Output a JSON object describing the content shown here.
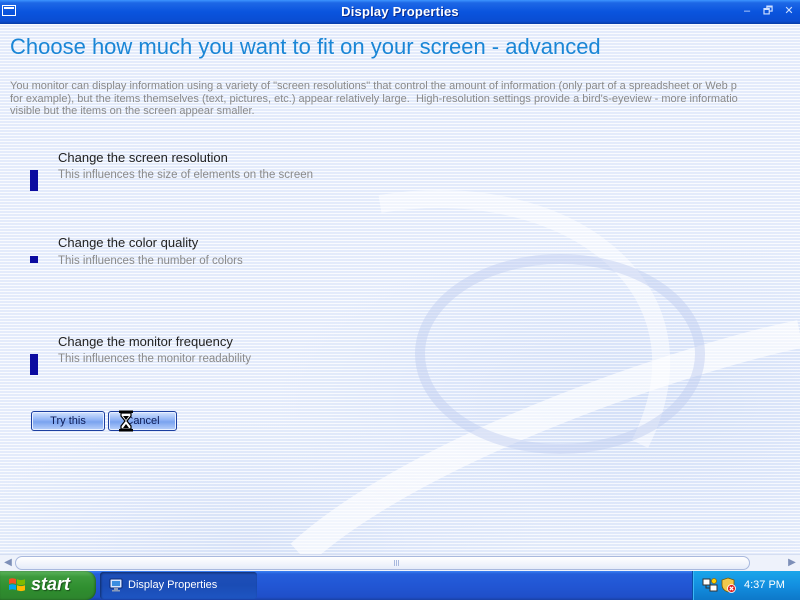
{
  "window": {
    "title": "Display Properties",
    "controls": {
      "minimize": "–",
      "restore": "🗗",
      "close": "✕"
    }
  },
  "page": {
    "heading": "Choose how much you want to fit on your screen - advanced",
    "intro": "You monitor can display information using a variety of \"screen resolutions\" that control the amount of information (only part of a spreadsheet or Web p\nfor example), but the items themselves (text, pictures, etc.) appear relatively large.  High-resolution settings provide a bird's-eyeview - more informatio\nvisible but the items on the screen appear smaller."
  },
  "settings": [
    {
      "title": "Change the screen resolution",
      "description": "This influences the size of elements on the screen"
    },
    {
      "title": "Change the color quality",
      "description": "This influences the number of colors"
    },
    {
      "title": "Change the monitor frequency",
      "description": "This influences the monitor readability"
    }
  ],
  "buttons": {
    "try": "Try this",
    "cancel": "Cancel"
  },
  "cursor": "hourglass-icon",
  "taskbar": {
    "start_label": "start",
    "tasks": [
      {
        "label": "Display Properties",
        "icon": "display-properties-icon",
        "active": true
      }
    ],
    "tray_icons": [
      "network-connection-icon",
      "security-alert-icon"
    ],
    "clock": "4:37 PM"
  },
  "colors": {
    "heading": "#1a86d6",
    "marker": "#0b0ba0",
    "titlebar": "#0a54de",
    "start_button": "#3c9a3c",
    "tray": "#138fe0"
  }
}
